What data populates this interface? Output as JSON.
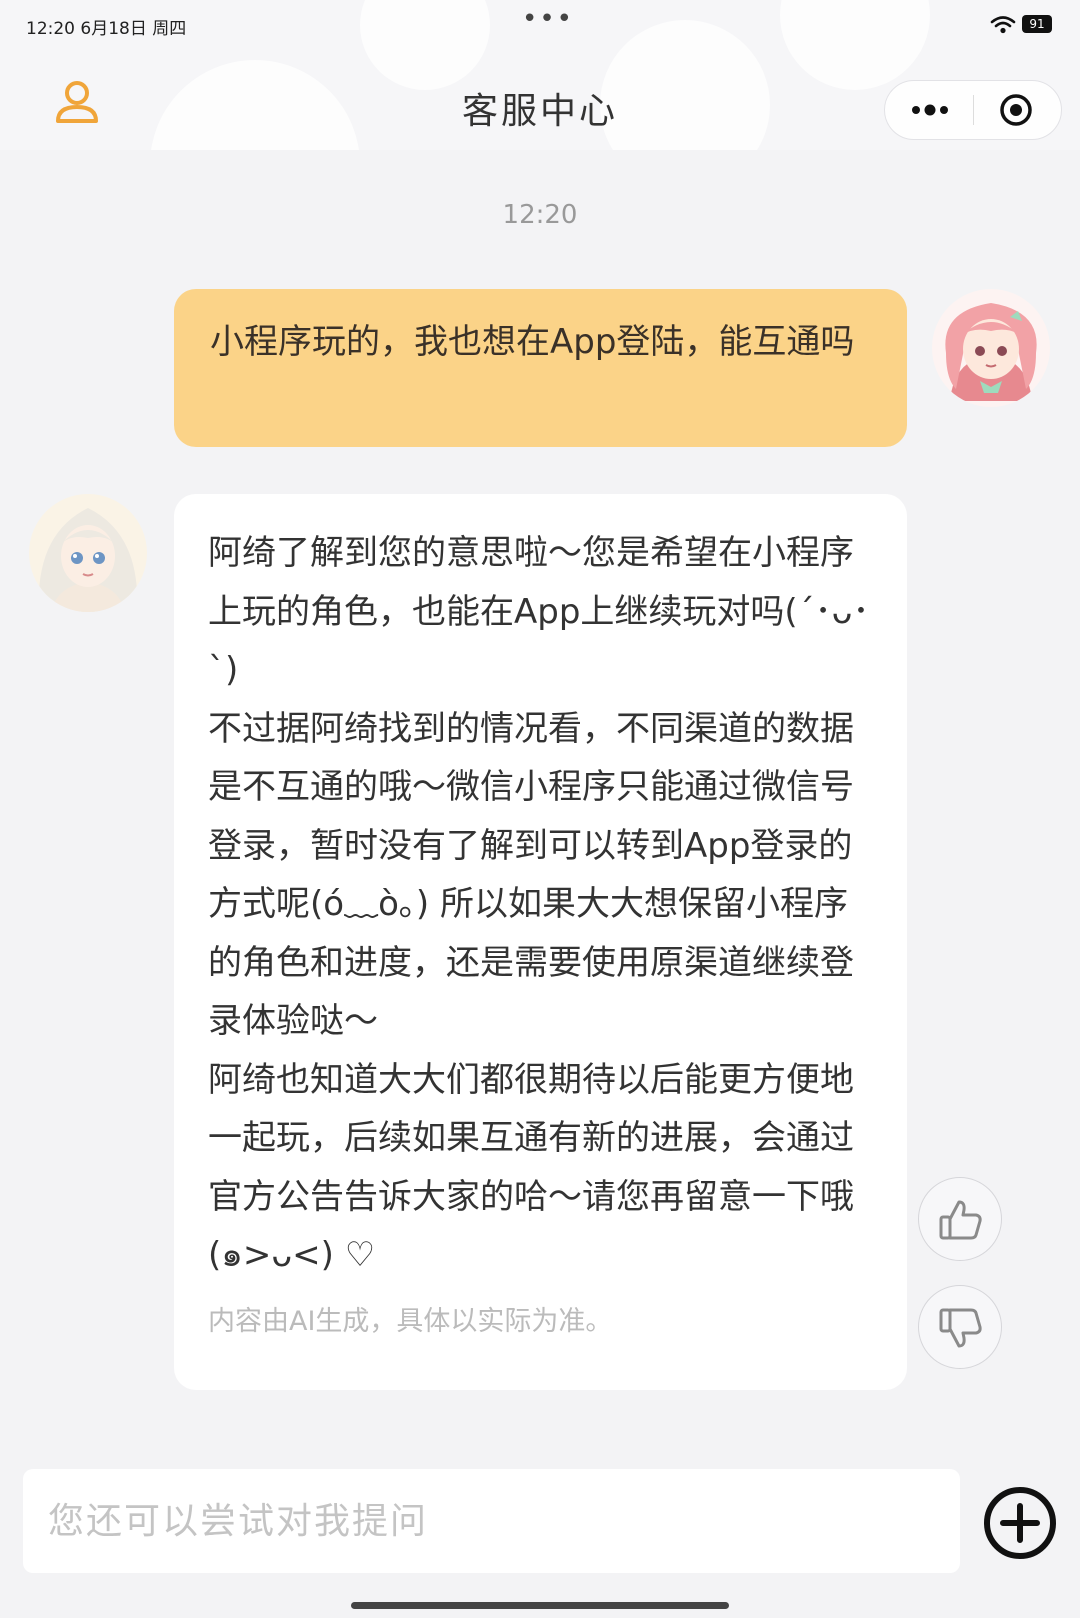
{
  "status_bar": {
    "time_date": "12:20  6月18日 周四",
    "battery": "91",
    "dots": "•••",
    "icons": [
      "wifi-icon",
      "battery-icon"
    ]
  },
  "header": {
    "title": "客服中心",
    "left_icon": "person-icon",
    "capsule_icons": [
      "more-icon",
      "target-icon"
    ],
    "accent_color": "#f0a53a"
  },
  "chat": {
    "timestamp": "12:20",
    "user_message": "小程序玩的，我也想在App登陆，能互通吗",
    "user_bubble_color": "#fbd388",
    "bot_message_paragraphs": [
      "阿绮了解到您的意思啦～您是希望在小程序上玩的角色，也能在App上继续玩对吗(´･ᴗ･`)",
      "不过据阿绮找到的情况看，不同渠道的数据是不互通的哦～微信小程序只能通过微信号登录，暂时没有了解到可以转到App登录的方式呢(ó﹏ò｡) 所以如果大大想保留小程序的角色和进度，还是需要使用原渠道继续登录体验哒～",
      "阿绮也知道大大们都很期待以后能更方便地一起玩，后续如果互通有新的进展，会通过官方公告告诉大家的哈～请您再留意一下哦(๑>ᴗ<) ♡"
    ],
    "disclaimer": "内容由AI生成，具体以实际为准。",
    "feedback_icons": [
      "thumbs-up-icon",
      "thumbs-down-icon"
    ]
  },
  "input": {
    "placeholder": "您还可以尝试对我提问",
    "value": "",
    "plus_icon": "plus-circle-icon"
  }
}
